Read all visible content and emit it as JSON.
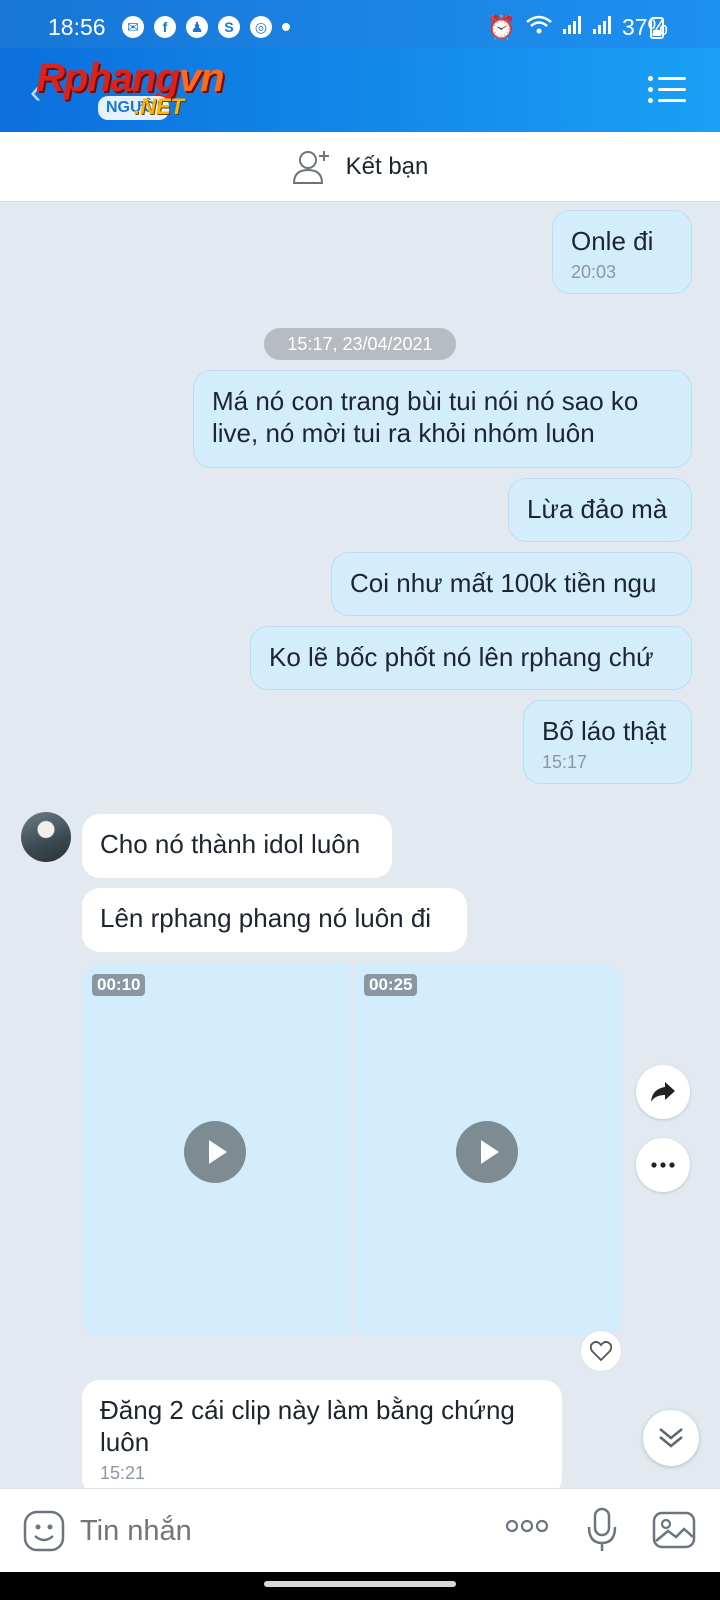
{
  "status_bar": {
    "time": "18:56",
    "battery": "37%"
  },
  "header": {
    "logo_main": "Rphang",
    "logo_accent": "vn",
    "logo_suffix": ".NET",
    "logo_chip": "NGƯỜI"
  },
  "add_friend": {
    "label": "Kết bạn"
  },
  "messages": {
    "m1": {
      "text": "Onle đi",
      "time": "20:03"
    },
    "date_separator": "15:17, 23/04/2021",
    "m2": {
      "text": "Má nó con trang bùi tui nói nó sao ko live, nó mời tui ra khỏi nhóm luôn"
    },
    "m3": {
      "text": "Lừa đảo mà"
    },
    "m4": {
      "text": "Coi như mất 100k tiền ngu"
    },
    "m5": {
      "text": "Ko lẽ bốc phốt nó lên rphang chứ"
    },
    "m6": {
      "text": "Bố láo thật",
      "time": "15:17"
    },
    "r1": {
      "text": "Cho nó thành idol luôn"
    },
    "r2": {
      "text": "Lên rphang phang nó luôn đi"
    },
    "videos": [
      {
        "duration": "00:10"
      },
      {
        "duration": "00:25"
      }
    ],
    "r3": {
      "text": "Đăng 2 cái clip này làm bằng chứng luôn",
      "time": "15:21"
    }
  },
  "input": {
    "placeholder": "Tin nhắn"
  },
  "colors": {
    "header_start": "#0b6fdd",
    "header_end": "#1aa0f5",
    "outgoing_bubble": "#d4edfc",
    "incoming_bubble": "#ffffff",
    "chat_bg": "#e2e9f1"
  }
}
